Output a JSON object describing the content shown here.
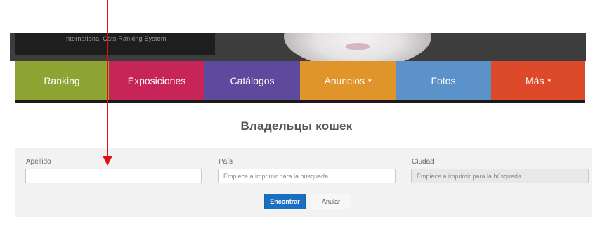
{
  "brand": {
    "text": "International Cats Ranking System"
  },
  "nav": {
    "items": [
      {
        "label": "Ranking",
        "color": "#8ea534",
        "caret": ""
      },
      {
        "label": "Exposiciones",
        "color": "#c7245a",
        "caret": ""
      },
      {
        "label": "Catálogos",
        "color": "#5e4a9c",
        "caret": ""
      },
      {
        "label": "Anuncios",
        "color": "#e0952a",
        "caret": "▾"
      },
      {
        "label": "Fotos",
        "color": "#5b92c9",
        "caret": ""
      },
      {
        "label": "Más",
        "color": "#dc4a2a",
        "caret": "▾"
      }
    ]
  },
  "page": {
    "title": "Владельцы кошек"
  },
  "filters": {
    "surname": {
      "label": "Apellido",
      "value": "",
      "placeholder": ""
    },
    "country": {
      "label": "País",
      "value": "",
      "placeholder": "Empiece a imprimir para la búsqueda"
    },
    "city": {
      "label": "Ciudad",
      "value": "",
      "placeholder": "Empiece a imprimir para la búsqueda"
    },
    "find_label": "Encontrar",
    "cancel_label": "Anular"
  },
  "colors": {
    "accent": "#1b6ec2",
    "annotation": "#e01010",
    "panel_bg": "#f2f2f2"
  }
}
